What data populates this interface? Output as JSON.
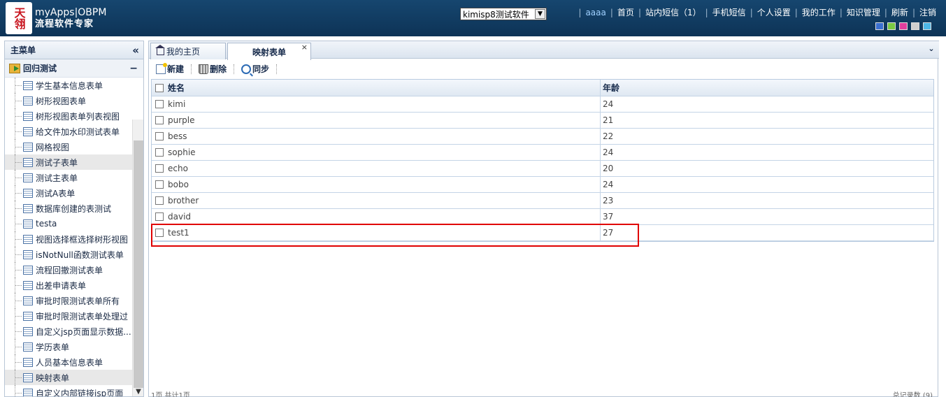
{
  "header": {
    "logo_text": "天翎",
    "brand_line1": "myApps|OBPM",
    "brand_line2": "流程软件专家",
    "app_select": "kimisp8测试软件",
    "user": "aaaa",
    "nav": [
      "首页",
      "站内短信（1）",
      "手机短信",
      "个人设置",
      "我的工作",
      "知识管理",
      "刷新",
      "注销"
    ],
    "theme_colors": [
      "#3a6fd0",
      "#7ac943",
      "#e03e9e",
      "#cfcfcf",
      "#4db7e8"
    ]
  },
  "sidebar": {
    "title": "主菜单",
    "group": "回归测试",
    "items": [
      "学生基本信息表单",
      "树形视图表单",
      "树形视图表单列表视图",
      "给文件加水印测试表单",
      "网格视图",
      "测试子表单",
      "测试主表单",
      "测试A表单",
      "数据库创建的表测试",
      "testa",
      "视图选择框选择树形视图",
      "isNotNull函数测试表单",
      "流程回撤测试表单",
      "出差申请表单",
      "审批时限测试表单所有",
      "审批时限测试表单处理过",
      "自定义jsp页面显示数据...",
      "学历表单",
      "人员基本信息表单",
      "映射表单",
      "自定义内部链接jsp页面"
    ]
  },
  "tabs": {
    "home": "我的主页",
    "active": "映射表单"
  },
  "toolbar": {
    "new": "新建",
    "delete": "删除",
    "sync": "同步"
  },
  "table": {
    "headers": [
      "姓名",
      "年龄"
    ],
    "rows": [
      [
        "kimi",
        "24"
      ],
      [
        "purple",
        "21"
      ],
      [
        "bess",
        "22"
      ],
      [
        "sophie",
        "24"
      ],
      [
        "echo",
        "20"
      ],
      [
        "bobo",
        "24"
      ],
      [
        "brother",
        "23"
      ],
      [
        "david",
        "37"
      ],
      [
        "test1",
        "27"
      ]
    ]
  },
  "footer": {
    "paging": "1页 共计1页",
    "total": "总记录数 (9)"
  }
}
